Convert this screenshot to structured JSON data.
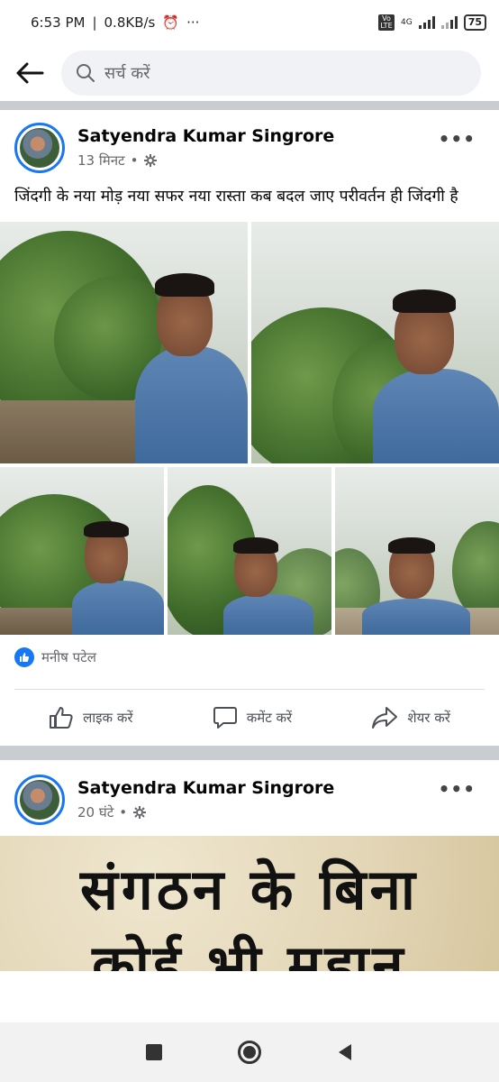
{
  "status_bar": {
    "time": "6:53 PM",
    "speed": "0.8KB/s",
    "net_label": "4G",
    "volte_label": "Vo LTE",
    "battery": "75"
  },
  "search": {
    "placeholder": "सर्च करें"
  },
  "posts": [
    {
      "author": "Satyendra Kumar Singrore",
      "time": "13 मिनट",
      "text": "जिंदगी के नया मोड़ नया सफर नया रास्ता कब बदल जाए  परीवर्तन ही जिंदगी है",
      "reaction_name": "मनीष पटेल",
      "actions": {
        "like": "लाइक करें",
        "comment": "कमेंट करें",
        "share": "शेयर करें"
      }
    },
    {
      "author": "Satyendra Kumar Singrore",
      "time": "20 घंटे",
      "image_text_line1": "संगठन के बिना",
      "image_text_line2": "कोई भी महान"
    }
  ],
  "colors": {
    "accent": "#1877f2",
    "secondary_text": "#65676b"
  },
  "icons": [
    "back-arrow-icon",
    "search-icon",
    "more-options-icon",
    "audience-gear-icon",
    "like-icon",
    "comment-icon",
    "share-icon",
    "stop-square-icon",
    "home-circle-icon",
    "back-triangle-icon"
  ]
}
